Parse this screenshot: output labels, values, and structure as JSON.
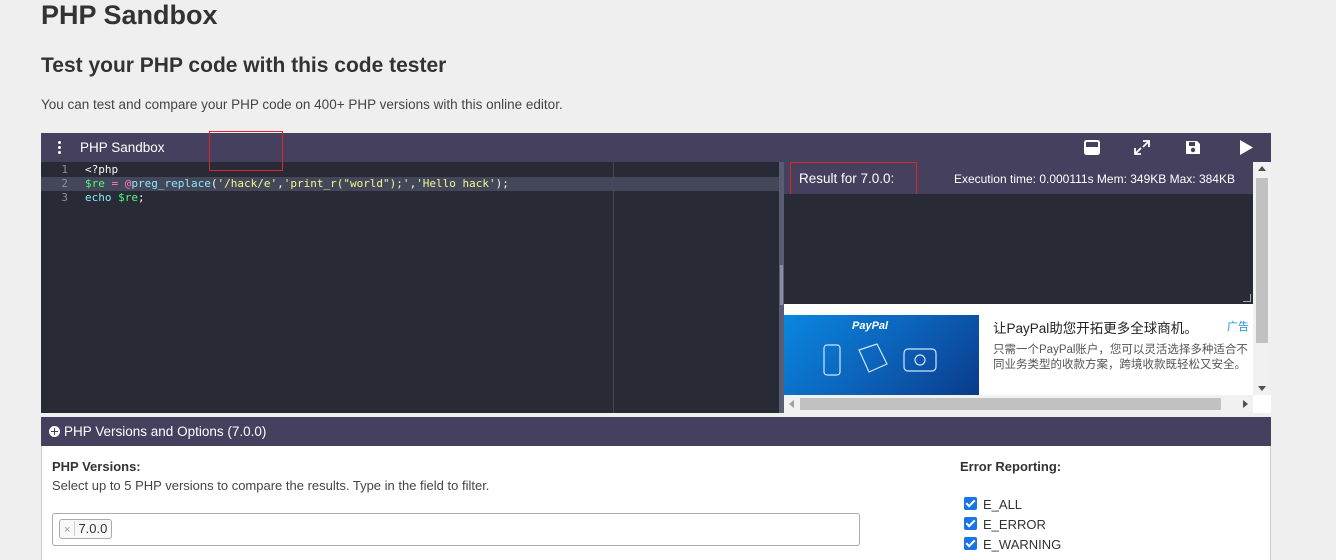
{
  "page": {
    "title": "PHP Sandbox",
    "subtitle": "Test your PHP code with this code tester",
    "description": "You can test and compare your PHP code on 400+ PHP versions with this online editor."
  },
  "toolbar": {
    "title": "PHP Sandbox",
    "icons": [
      "menu-dots-icon",
      "layout-icon",
      "fullscreen-icon",
      "save-icon",
      "run-icon"
    ]
  },
  "editor": {
    "line_numbers": [
      "1",
      "2",
      "3"
    ],
    "lines": [
      "<?php",
      "$re = @preg_replace('/hack/e','print_r(\"world\");','Hello hack');",
      "echo $re;"
    ],
    "active_line": 2
  },
  "result": {
    "label": "Result for 7.0.0:",
    "exec_info": "Execution time: 0.000111s Mem: 349KB Max: 384KB"
  },
  "ad": {
    "logo": "PayPal",
    "title": "让PayPal助您开拓更多全球商机。",
    "tag": "广告",
    "body": "只需一个PayPal账户，您可以灵活选择多种适合不同业务类型的收款方案，跨境收款既轻松又安全。"
  },
  "options": {
    "title": "PHP Versions and Options (7.0.0)",
    "versions_label": "PHP Versions:",
    "versions_help": "Select up to 5 PHP versions to compare the results. Type in the field to filter.",
    "selected_versions": [
      "7.0.0"
    ],
    "error_label": "Error Reporting:",
    "error_items": [
      "E_ALL",
      "E_ERROR",
      "E_WARNING"
    ]
  },
  "colors": {
    "toolbar_bg": "#44405e",
    "editor_bg": "#282a36",
    "highlight_border": "#e0242c",
    "checkbox": "#1a73e8"
  }
}
